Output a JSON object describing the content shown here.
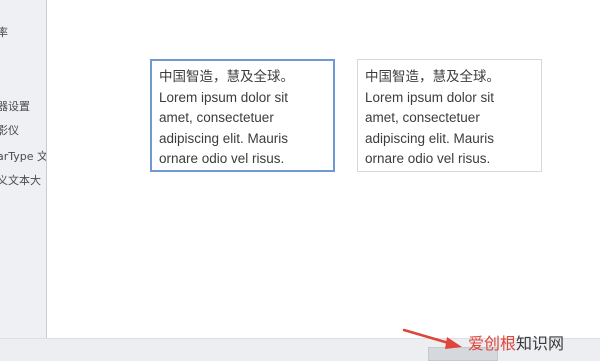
{
  "sidebar": {
    "items": [
      {
        "label": "率"
      },
      {
        "label": "器设置"
      },
      {
        "label": "影仪"
      },
      {
        "label": "arType 文"
      },
      {
        "label": "义文本大"
      }
    ]
  },
  "previews": [
    {
      "line1": "中国智造，慧及全球。",
      "line2": "Lorem ipsum dolor sit",
      "line3": "amet, consectetuer",
      "line4": "adipiscing elit. Mauris",
      "line5": "ornare odio vel risus."
    },
    {
      "line1": "中国智造，慧及全球。",
      "line2": "Lorem ipsum dolor sit",
      "line3": "amet, consectetuer",
      "line4": "adipiscing elit. Mauris",
      "line5": "ornare odio vel risus."
    }
  ],
  "watermark": {
    "part1": "爱创根",
    "part2": "知识网"
  },
  "colors": {
    "selected_border": "#6f98d4",
    "arrow": "#e0453a"
  }
}
